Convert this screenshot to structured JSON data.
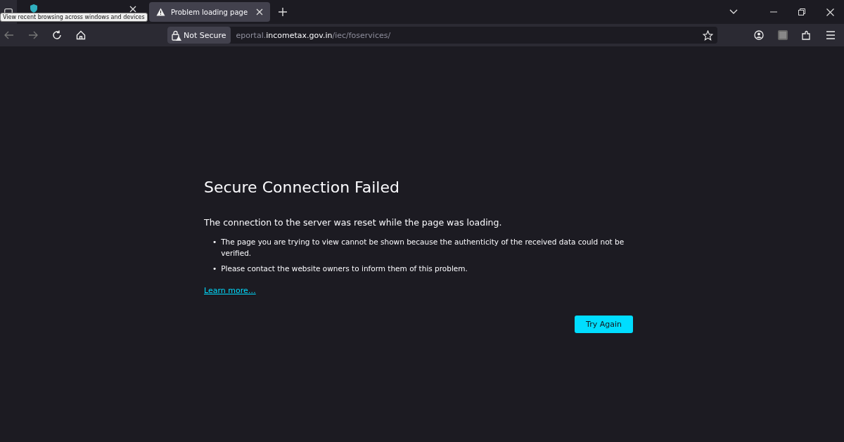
{
  "tabs": [
    {
      "selected": false,
      "warning": false
    },
    {
      "title": "Problem loading page",
      "selected": true,
      "warning": true
    }
  ],
  "tooltip": "View recent browsing across windows and devices",
  "address": {
    "security": "Not Secure",
    "url_prefix": "eportal.",
    "url_domain": "incometax.gov.in",
    "url_path": "/iec/foservices/"
  },
  "error": {
    "title": "Secure Connection Failed",
    "summary": "The connection to the server was reset while the page was loading.",
    "bullets": [
      {
        "marker": "•",
        "text": "The page you are trying to view cannot be shown because the authenticity of the received data could not be verified."
      },
      {
        "marker": "•",
        "text": "Please contact the website owners to inform them of this problem."
      }
    ],
    "link": "Learn more…",
    "button": "Try Again"
  }
}
